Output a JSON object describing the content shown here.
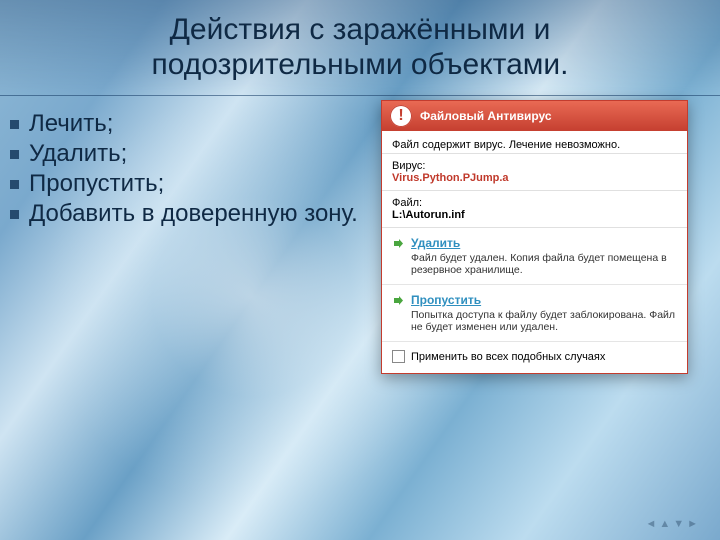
{
  "slide": {
    "title": "Действия с заражёнными и подозрительными объектами.",
    "bullets": [
      "Лечить;",
      "Удалить;",
      "Пропустить;",
      "Добавить в доверенную зону."
    ]
  },
  "dialog": {
    "header": "Файловый Антивирус",
    "subtitle": "Файл содержит вирус. Лечение невозможно.",
    "virus_label": "Вирус:",
    "virus_value": "Virus.Python.PJump.a",
    "file_label": "Файл:",
    "file_value": "L:\\Autorun.inf",
    "actions": [
      {
        "label": "Удалить",
        "desc": "Файл будет удален. Копия файла будет помещена в резервное хранилище."
      },
      {
        "label": "Пропустить",
        "desc": "Попытка доступа к файлу будет заблокирована. Файл не будет изменен или удален."
      }
    ],
    "checkbox_label": "Применить во всех подобных случаях"
  }
}
